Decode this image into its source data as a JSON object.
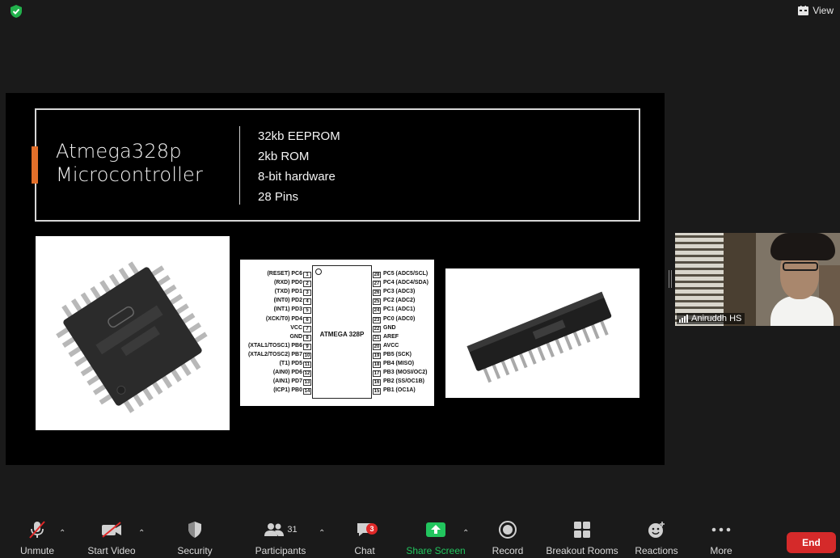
{
  "header": {
    "view_label": "View"
  },
  "slide": {
    "title_line1": "Atmega328p",
    "title_line2": "Microcontroller",
    "specs": [
      "32kb EEPROM",
      "2kb ROM",
      "8-bit hardware",
      "28 Pins"
    ],
    "pinout": {
      "chip_label": "ATMEGA 328P",
      "left_pins": [
        {
          "n": "1",
          "label": "(RESET) PC6"
        },
        {
          "n": "2",
          "label": "(RXD) PD0"
        },
        {
          "n": "3",
          "label": "(TXD) PD1"
        },
        {
          "n": "4",
          "label": "(INT0) PD2"
        },
        {
          "n": "5",
          "label": "(INT1) PD3"
        },
        {
          "n": "6",
          "label": "(XCK/T0) PD4"
        },
        {
          "n": "7",
          "label": "VCC"
        },
        {
          "n": "8",
          "label": "GND"
        },
        {
          "n": "9",
          "label": "(XTAL1/TOSC1) PB6"
        },
        {
          "n": "10",
          "label": "(XTAL2/TOSC2) PB7"
        },
        {
          "n": "11",
          "label": "(T1) PD5"
        },
        {
          "n": "12",
          "label": "(AIN0) PD6"
        },
        {
          "n": "13",
          "label": "(AIN1) PD7"
        },
        {
          "n": "14",
          "label": "(ICP1) PB0"
        }
      ],
      "right_pins": [
        {
          "n": "28",
          "label": "PC5 (ADC5/SCL)"
        },
        {
          "n": "27",
          "label": "PC4 (ADC4/SDA)"
        },
        {
          "n": "26",
          "label": "PC3 (ADC3)"
        },
        {
          "n": "25",
          "label": "PC2 (ADC2)"
        },
        {
          "n": "24",
          "label": "PC1 (ADC1)"
        },
        {
          "n": "23",
          "label": "PC0 (ADC0)"
        },
        {
          "n": "22",
          "label": "GND"
        },
        {
          "n": "21",
          "label": "AREF"
        },
        {
          "n": "20",
          "label": "AVCC"
        },
        {
          "n": "19",
          "label": "PB5 (SCK)"
        },
        {
          "n": "18",
          "label": "PB4 (MISO)"
        },
        {
          "n": "17",
          "label": "PB3 (MOSI/OC2)"
        },
        {
          "n": "16",
          "label": "PB2 (SS/OC1B)"
        },
        {
          "n": "15",
          "label": "PB1 (OC1A)"
        }
      ]
    }
  },
  "participant": {
    "name": "Aniruddh HS"
  },
  "toolbar": {
    "unmute": "Unmute",
    "start_video": "Start Video",
    "security": "Security",
    "participants": "Participants",
    "participants_count": "31",
    "chat": "Chat",
    "chat_badge": "3",
    "share_screen": "Share Screen",
    "record": "Record",
    "breakout_rooms": "Breakout Rooms",
    "reactions": "Reactions",
    "more": "More",
    "end": "End"
  },
  "colors": {
    "accent": "#e36f2a",
    "share_green": "#22c55e",
    "end_red": "#d52a2a",
    "badge_red": "#e02828"
  }
}
